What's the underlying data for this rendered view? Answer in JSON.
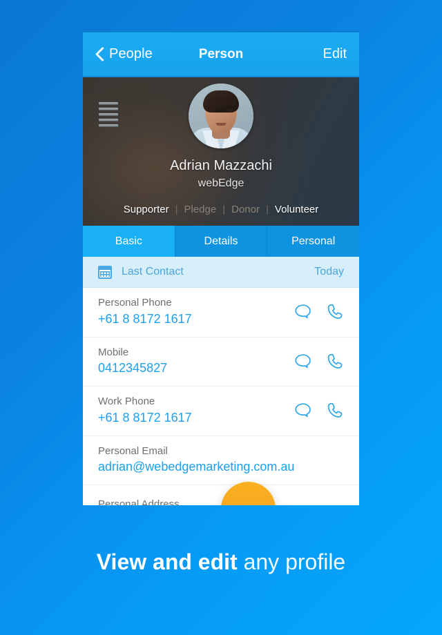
{
  "navbar": {
    "back_label": "People",
    "title": "Person",
    "edit_label": "Edit"
  },
  "profile": {
    "name": "Adrian Mazzachi",
    "organisation": "webEdge",
    "tags": [
      {
        "label": "Supporter",
        "active": true
      },
      {
        "label": "Pledge",
        "active": false
      },
      {
        "label": "Donor",
        "active": false
      },
      {
        "label": "Volunteer",
        "active": true
      }
    ],
    "separator": "|"
  },
  "tabs": [
    {
      "label": "Basic",
      "active": true
    },
    {
      "label": "Details",
      "active": false
    },
    {
      "label": "Personal",
      "active": false
    }
  ],
  "last_contact": {
    "label": "Last Contact",
    "value": "Today"
  },
  "rows": [
    {
      "label": "Personal Phone",
      "value": "+61 8 8172 1617"
    },
    {
      "label": "Mobile",
      "value": "0412345827"
    },
    {
      "label": "Work Phone",
      "value": "+61 8 8172 1617"
    },
    {
      "label": "Personal Email",
      "value": "adrian@webedgemarketing.com.au"
    },
    {
      "label": "Personal Address",
      "value": ""
    }
  ],
  "caption": {
    "bold": "View and edit",
    "light": " any profile"
  },
  "colors": {
    "accent_blue": "#1ba0f0",
    "nav_blue": "#19a9f2",
    "tab_active": "#19b0f5",
    "tab_inactive": "#0d93e0",
    "fab_orange": "#f5a623",
    "background_from": "#0a77d4",
    "background_to": "#05a6fc"
  }
}
